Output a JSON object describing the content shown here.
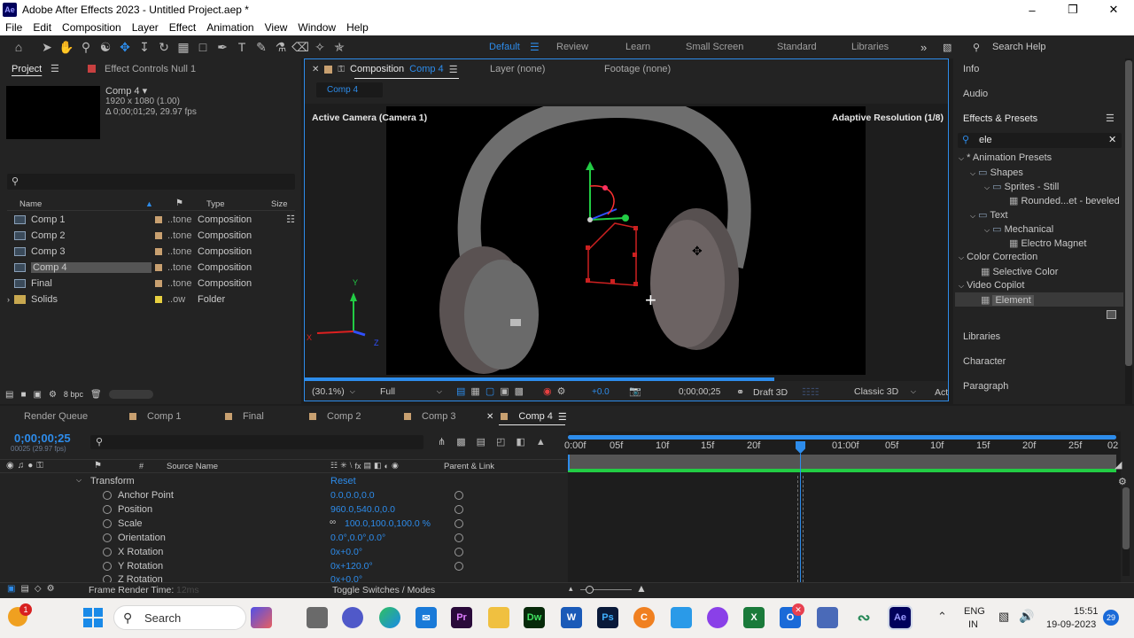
{
  "window": {
    "app_icon": "Ae",
    "title": "Adobe After Effects 2023 - Untitled Project.aep *",
    "controls": [
      "minimize-icon",
      "maximize-icon",
      "close-icon"
    ]
  },
  "menu": [
    "File",
    "Edit",
    "Composition",
    "Layer",
    "Effect",
    "Animation",
    "View",
    "Window",
    "Help"
  ],
  "workspaces": {
    "items": [
      "Default",
      "Review",
      "Learn",
      "Small Screen",
      "Standard",
      "Libraries"
    ],
    "active": "Default",
    "search_help": "Search Help"
  },
  "project": {
    "tab_project": "Project",
    "tab_effect_controls": "Effect Controls Null 1",
    "comp_name": "Comp 4 ▾",
    "comp_res": "1920 x 1080 (1.00)",
    "comp_duration": "Δ 0;00;01;29, 29.97 fps",
    "search_placeholder": "",
    "columns": {
      "name": "Name",
      "type": "Type",
      "size": "Size"
    },
    "items": [
      {
        "name": "Comp 1",
        "label": "..tone",
        "type": "Composition",
        "color": "#c8a070"
      },
      {
        "name": "Comp 2",
        "label": "..tone",
        "type": "Composition",
        "color": "#c8a070"
      },
      {
        "name": "Comp 3",
        "label": "..tone",
        "type": "Composition",
        "color": "#c8a070"
      },
      {
        "name": "Comp 4",
        "label": "..tone",
        "type": "Composition",
        "color": "#c8a070"
      },
      {
        "name": "Final",
        "label": "..tone",
        "type": "Composition",
        "color": "#c8a070"
      },
      {
        "name": "Solids",
        "label": "..ow",
        "type": "Folder",
        "color": "#e8d040"
      }
    ],
    "bpc": "8 bpc"
  },
  "viewer": {
    "tab_composition": "Composition",
    "tab_composition_name": "Comp 4",
    "tab_layer": "Layer (none)",
    "tab_footage": "Footage (none)",
    "breadcrumb": "Comp 4",
    "camera_label": "Active Camera (Camera 1)",
    "resolution_label": "Adaptive Resolution (1/8)",
    "zoom": "(30.1%)",
    "quality": "Full",
    "exposure": "+0.0",
    "timecode": "0;00;00;25",
    "draft3d": "Draft 3D",
    "renderer": "Classic 3D",
    "view_btn": "Act"
  },
  "right_panel": {
    "info": "Info",
    "audio": "Audio",
    "effects_presets": "Effects & Presets",
    "search_value": "ele",
    "tree": [
      {
        "text": "* Animation Presets",
        "level": 0,
        "kind": "folder-open"
      },
      {
        "text": "Shapes",
        "level": 1,
        "kind": "folder-open"
      },
      {
        "text": "Sprites - Still",
        "level": 2,
        "kind": "folder-open"
      },
      {
        "text": "Rounded...et - beveled",
        "level": 3,
        "kind": "preset"
      },
      {
        "text": "Text",
        "level": 1,
        "kind": "folder-open"
      },
      {
        "text": "Mechanical",
        "level": 2,
        "kind": "folder-open"
      },
      {
        "text": "Electro Magnet",
        "level": 3,
        "kind": "preset"
      },
      {
        "text": "Color Correction",
        "level": 0,
        "kind": "category"
      },
      {
        "text": "Selective Color",
        "level": 1,
        "kind": "effect"
      },
      {
        "text": "Video Copilot",
        "level": 0,
        "kind": "category"
      },
      {
        "text": "Element",
        "level": 1,
        "kind": "effect-selected"
      }
    ],
    "libraries": "Libraries",
    "character": "Character",
    "paragraph": "Paragraph"
  },
  "timeline": {
    "tabs": [
      "Render Queue",
      "Comp 1",
      "Final",
      "Comp 2",
      "Comp 3",
      "Comp 4"
    ],
    "active_tab": "Comp 4",
    "timecode": "0;00;00;25",
    "frame_info": "00025 (29.97 fps)",
    "col_source": "Source Name",
    "col_parent": "Parent & Link",
    "ruler": [
      "0:00f",
      "05f",
      "10f",
      "15f",
      "20f",
      "2",
      "01:00f",
      "05f",
      "10f",
      "15f",
      "20f",
      "25f",
      "02"
    ],
    "transform": {
      "label": "Transform",
      "reset": "Reset"
    },
    "properties": [
      {
        "name": "Anchor Point",
        "value": "0.0,0.0,0.0"
      },
      {
        "name": "Position",
        "value": "960.0,540.0,0.0"
      },
      {
        "name": "Scale",
        "value": "100.0,100.0,100.0 %"
      },
      {
        "name": "Orientation",
        "value": "0.0°,0.0°,0.0°"
      },
      {
        "name": "X Rotation",
        "value": "0x+0.0°"
      },
      {
        "name": "Y Rotation",
        "value": "0x+120.0°"
      },
      {
        "name": "Z Rotation",
        "value": "0x+0.0°"
      }
    ],
    "frame_render_label": "Frame Render Time:",
    "frame_render_value": "12ms",
    "toggle_label": "Toggle Switches / Modes"
  },
  "taskbar": {
    "search": "Search",
    "notification_count": "1",
    "lang": "ENG",
    "region": "IN",
    "time": "15:51",
    "date": "19-09-2023",
    "badge": "29",
    "apps": [
      "windows-icon",
      "teams-icon",
      "edge-icon",
      "mail-icon",
      "premiere-icon",
      "explorer-icon",
      "dreamweaver-icon",
      "word-icon",
      "photoshop-icon",
      "canva-icon",
      "python-icon",
      "discord-icon",
      "excel-icon",
      "outlook-icon",
      "app-icon",
      "code-icon",
      "aftereffects-icon"
    ]
  }
}
